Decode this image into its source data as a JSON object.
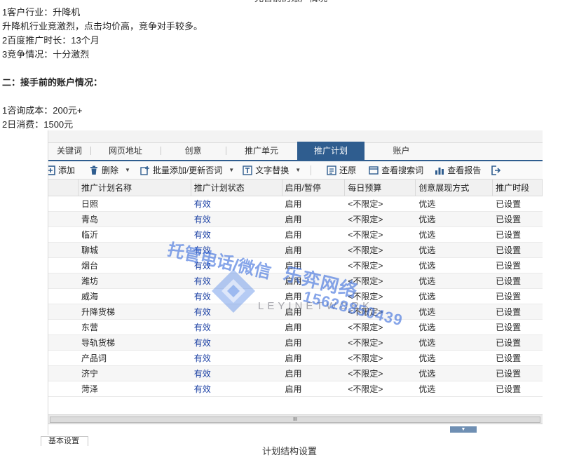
{
  "article": {
    "cut_title": "兄日前的账户情况",
    "lines": [
      "1客户行业：升降机",
      "升降机行业竞激烈，点击均价高，竞争对手较多。",
      "2百度推广时长：13个月",
      "3竞争情况：十分激烈"
    ],
    "section_title": "二：接手前的账户情况：",
    "stats": [
      "1咨询成本：200元+",
      "2日消费：1500元"
    ]
  },
  "tabs": [
    {
      "label": "关键词",
      "active": false
    },
    {
      "label": "网页地址",
      "active": false
    },
    {
      "label": "创意",
      "active": false
    },
    {
      "label": "推广单元",
      "active": false
    },
    {
      "label": "推广计划",
      "active": true
    },
    {
      "label": "账户",
      "active": false
    }
  ],
  "toolbar": {
    "add": "添加",
    "delete": "删除",
    "batch": "批量添加/更新否词",
    "replace": "文字替换",
    "restore": "还原",
    "search_terms": "查看搜索词",
    "report": "查看报告"
  },
  "table": {
    "headers": [
      "推广计划名称",
      "推广计划状态",
      "启用/暂停",
      "每日预算",
      "创意展现方式",
      "推广时段"
    ],
    "rows": [
      [
        "日照",
        "有效",
        "启用",
        "<不限定>",
        "优选",
        "已设置"
      ],
      [
        "青岛",
        "有效",
        "启用",
        "<不限定>",
        "优选",
        "已设置"
      ],
      [
        "临沂",
        "有效",
        "启用",
        "<不限定>",
        "优选",
        "已设置"
      ],
      [
        "聊城",
        "有效",
        "启用",
        "<不限定>",
        "优选",
        "已设置"
      ],
      [
        "烟台",
        "有效",
        "启用",
        "<不限定>",
        "优选",
        "已设置"
      ],
      [
        "潍坊",
        "有效",
        "启用",
        "<不限定>",
        "优选",
        "已设置"
      ],
      [
        "威海",
        "有效",
        "启用",
        "<不限定>",
        "优选",
        "已设置"
      ],
      [
        "升降货梯",
        "有效",
        "启用",
        "<不限定>",
        "优选",
        "已设置"
      ],
      [
        "东营",
        "有效",
        "启用",
        "<不限定>",
        "优选",
        "已设置"
      ],
      [
        "导轨货梯",
        "有效",
        "启用",
        "<不限定>",
        "优选",
        "已设置"
      ],
      [
        "产品词",
        "有效",
        "启用",
        "<不限定>",
        "优选",
        "已设置"
      ],
      [
        "济宁",
        "有效",
        "启用",
        "<不限定>",
        "优选",
        "已设置"
      ],
      [
        "菏泽",
        "有效",
        "启用",
        "<不限定>",
        "优选",
        "已设置"
      ]
    ]
  },
  "scroll_grip": "III",
  "bottom_tab": "基本设置",
  "caption": "计划结构设置",
  "watermark": {
    "line1": "托管电话/微信",
    "brand_cn": "乐弈网络",
    "brand_en": "LEYINETWORK",
    "phone": "15628850439"
  },
  "colors": {
    "tab_active": "#2f5d8f",
    "status_text": "#1a3fa3",
    "watermark": "#3c6edc"
  }
}
